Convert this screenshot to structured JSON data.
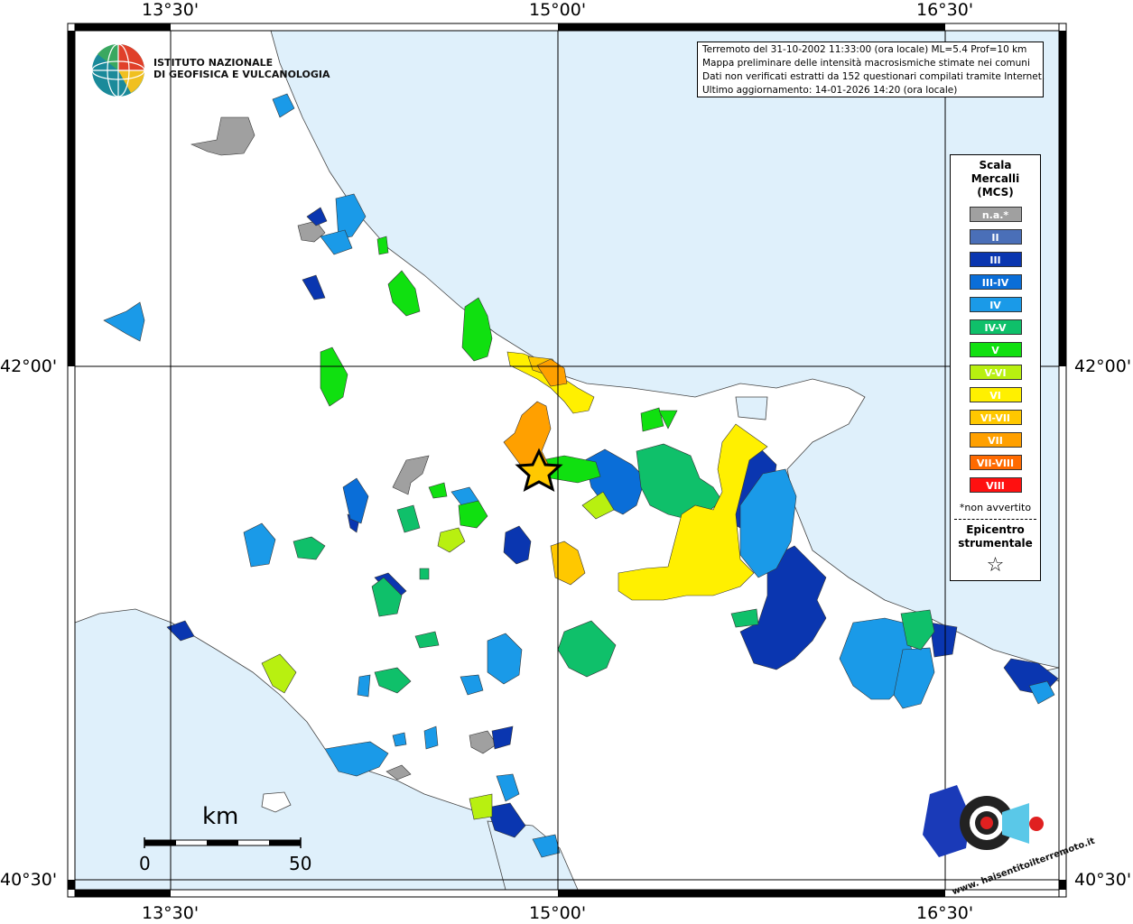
{
  "axes": {
    "top": [
      "13°30'",
      "15°00'",
      "16°30'"
    ],
    "bottom": [
      "13°30'",
      "15°00'",
      "16°30'"
    ],
    "left": [
      "42°00'",
      "40°30'"
    ],
    "right": [
      "42°00'",
      "40°30'"
    ]
  },
  "info": {
    "line1": "Terremoto del 31-10-2002 11:33:00 (ora locale) ML=5.4 Prof=10 km",
    "line2": "Mappa preliminare delle intensità macrosismiche stimate nei comuni",
    "line3": "Dati non verificati estratti da 152 questionari compilati tramite Internet.",
    "line4": "Ultimo aggiornamento: 14-01-2026 14:20 (ora locale)"
  },
  "logo": {
    "line1": "ISTITUTO NAZIONALE",
    "line2": "DI GEOFISICA E VULCANOLOGIA"
  },
  "legend": {
    "title1": "Scala",
    "title2": "Mercalli",
    "title3": "(MCS)",
    "items": [
      {
        "label": "n.a.*",
        "color": "#a0a0a0"
      },
      {
        "label": "II",
        "color": "#4a6fb8"
      },
      {
        "label": "III",
        "color": "#0a36b0"
      },
      {
        "label": "III-IV",
        "color": "#0a6ed8"
      },
      {
        "label": "IV",
        "color": "#1a9ae8"
      },
      {
        "label": "IV-V",
        "color": "#0fc06a"
      },
      {
        "label": "V",
        "color": "#10e010"
      },
      {
        "label": "V-VI",
        "color": "#b8f010"
      },
      {
        "label": "VI",
        "color": "#fff000"
      },
      {
        "label": "VI-VII",
        "color": "#ffc800"
      },
      {
        "label": "VII",
        "color": "#ffa000"
      },
      {
        "label": "VII-VIII",
        "color": "#ff6a00"
      },
      {
        "label": "VIII",
        "color": "#ff1010"
      }
    ],
    "note": "*non avvertito",
    "epi1": "Epicentro",
    "epi2": "strumentale",
    "epi_symbol": "☆"
  },
  "scalebar": {
    "unit": "km",
    "min": "0",
    "max": "50"
  },
  "brand": {
    "text": "haisentitoilterremoto.it",
    "www": "www."
  },
  "colors": {
    "sea": "#dff0fb",
    "land": "#ffffff",
    "grid": "#000000"
  }
}
